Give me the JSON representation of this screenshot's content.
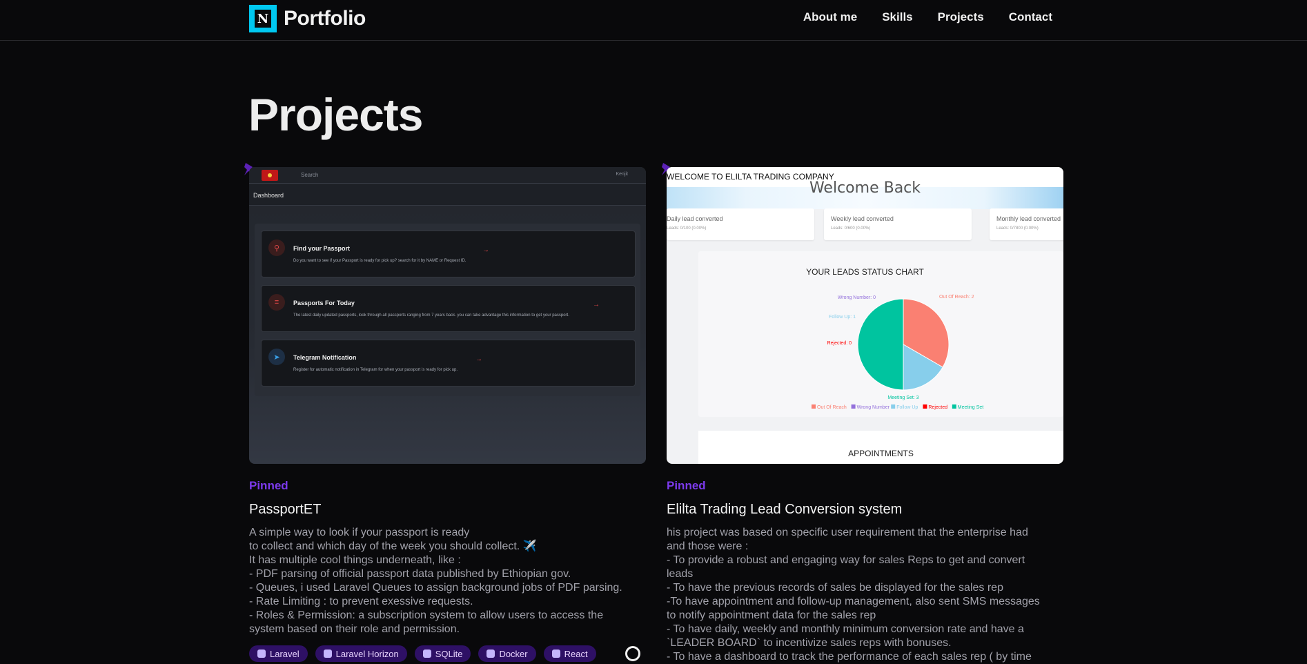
{
  "header": {
    "logo_letter": "N",
    "brand": "Portfolio",
    "nav": [
      "About me",
      "Skills",
      "Projects",
      "Contact"
    ]
  },
  "page_title": "Projects",
  "colors": {
    "accent": "#7c3aed",
    "logo_bg": "#00c8f0",
    "background": "#09090b"
  },
  "projects": [
    {
      "pinned_label": "Pinned",
      "title": "PassportET",
      "description": [
        "A simple way to look if your passport is ready",
        "to collect and which day of the week you should collect. ✈️",
        "It has multiple cool things underneath, like :",
        "- PDF parsing of official passport data published by Ethiopian gov.",
        "- Queues, i used Laravel Queues to assign background jobs of PDF parsing.",
        "- Rate Limiting : to prevent exessive requests.",
        "- Roles & Permission: a subscription system to allow users to access the",
        "system based on their role and permission."
      ],
      "tech": [
        "Laravel",
        "Laravel Horizon",
        "SQLite",
        "Docker",
        "React"
      ],
      "screenshot": {
        "search": "Search",
        "user": "Kenjit",
        "dashboard": "Dashboard",
        "cards": [
          {
            "icon": "search-icon",
            "title": "Find your Passport",
            "desc": "Do you want to see if your Passport is ready for pick up? search for it by NAME or Request ID."
          },
          {
            "icon": "list-icon",
            "title": "Passports For Today",
            "desc": "The latest daily updated passports, look through all passports ranging from 7 years back. you can take advantage this information to get your passport."
          },
          {
            "icon": "telegram-icon",
            "title": "Telegram Notification",
            "desc": "Register for automatic notification in Telegram for when your passport is ready for pick up."
          }
        ]
      }
    },
    {
      "pinned_label": "Pinned",
      "title": "Elilta Trading Lead Conversion system",
      "description": [
        "his project was based on specific user requirement that the enterprise had",
        "and those were :",
        "- To provide a robust and engaging way for sales Reps to get and convert",
        "leads",
        "- To have the previous records of sales be displayed for the sales rep",
        "-To have appointment and follow-up management, also sent SMS messages",
        "to notify appointment data for the sales rep",
        "- To have daily, weekly and monthly minimum conversion rate and have a",
        "`LEADER BOARD` to incentivize sales reps with bonuses.",
        "- To have a dashboard to track the performance of each sales rep ( by time"
      ],
      "screenshot": {
        "company": "WELCOME TO ELILTA TRADING COMPANY",
        "welcome": "Welcome Back",
        "stats": [
          {
            "title": "Daily lead converted",
            "sub": "Leads: 0/100 (0.00%)"
          },
          {
            "title": "Weekly lead converted",
            "sub": "Leads: 0/600 (0.00%)"
          },
          {
            "title": "Monthly lead converted",
            "sub": "Leads: 0/7800 (0.00%)"
          }
        ],
        "chart_title": "YOUR LEADS STATUS CHART",
        "appointments": "APPOINTMENTS"
      }
    }
  ],
  "chart_data": {
    "type": "pie",
    "title": "YOUR LEADS STATUS CHART",
    "series": [
      {
        "name": "Out Of Reach",
        "value": 2,
        "label": "Out Of Reach: 2",
        "color": "#fa8072"
      },
      {
        "name": "Wrong Number",
        "value": 0,
        "label": "Wrong Number: 0",
        "color": "#9370db"
      },
      {
        "name": "Follow Up",
        "value": 1,
        "label": "Follow Up: 1",
        "color": "#87ceeb"
      },
      {
        "name": "Rejected",
        "value": 0,
        "label": "Rejected: 0",
        "color": "#ff0000"
      },
      {
        "name": "Meeting Set",
        "value": 3,
        "label": "Meeting Set: 3",
        "color": "#00c49f"
      }
    ],
    "legend_position": "bottom"
  }
}
